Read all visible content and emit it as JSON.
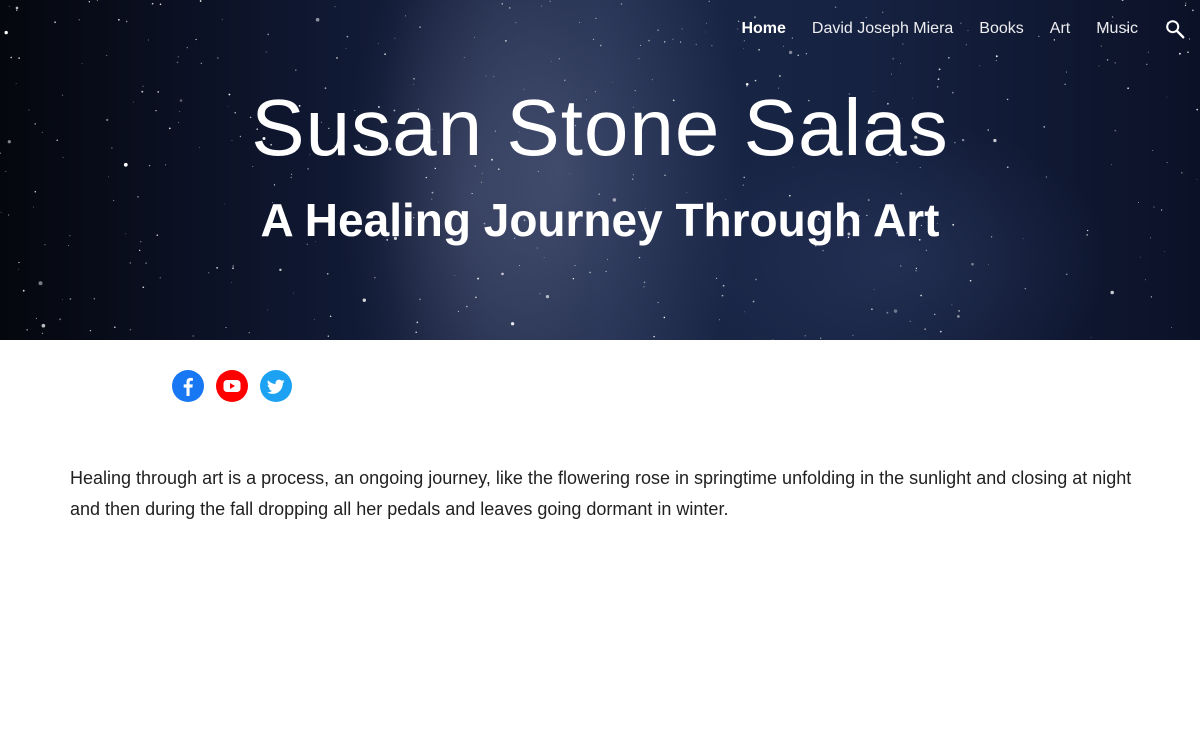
{
  "nav": {
    "items": [
      {
        "label": "Home",
        "active": true
      },
      {
        "label": "David Joseph Miera",
        "active": false
      },
      {
        "label": "Books",
        "active": false
      },
      {
        "label": "Art",
        "active": false
      },
      {
        "label": "Music",
        "active": false
      }
    ],
    "search_icon": "search-icon"
  },
  "hero": {
    "title": "Susan Stone Salas",
    "subtitle": "A Healing Journey Through Art"
  },
  "social": [
    {
      "name": "facebook-icon",
      "color": "#1877f2"
    },
    {
      "name": "youtube-icon",
      "color": "#ff0000"
    },
    {
      "name": "twitter-icon",
      "color": "#1da1f2"
    }
  ],
  "content": {
    "intro": "Healing through art is a process, an ongoing journey, like the flowering rose in springtime unfolding in the sunlight and closing at night and then during the fall dropping all her pedals and leaves going dormant in winter."
  }
}
